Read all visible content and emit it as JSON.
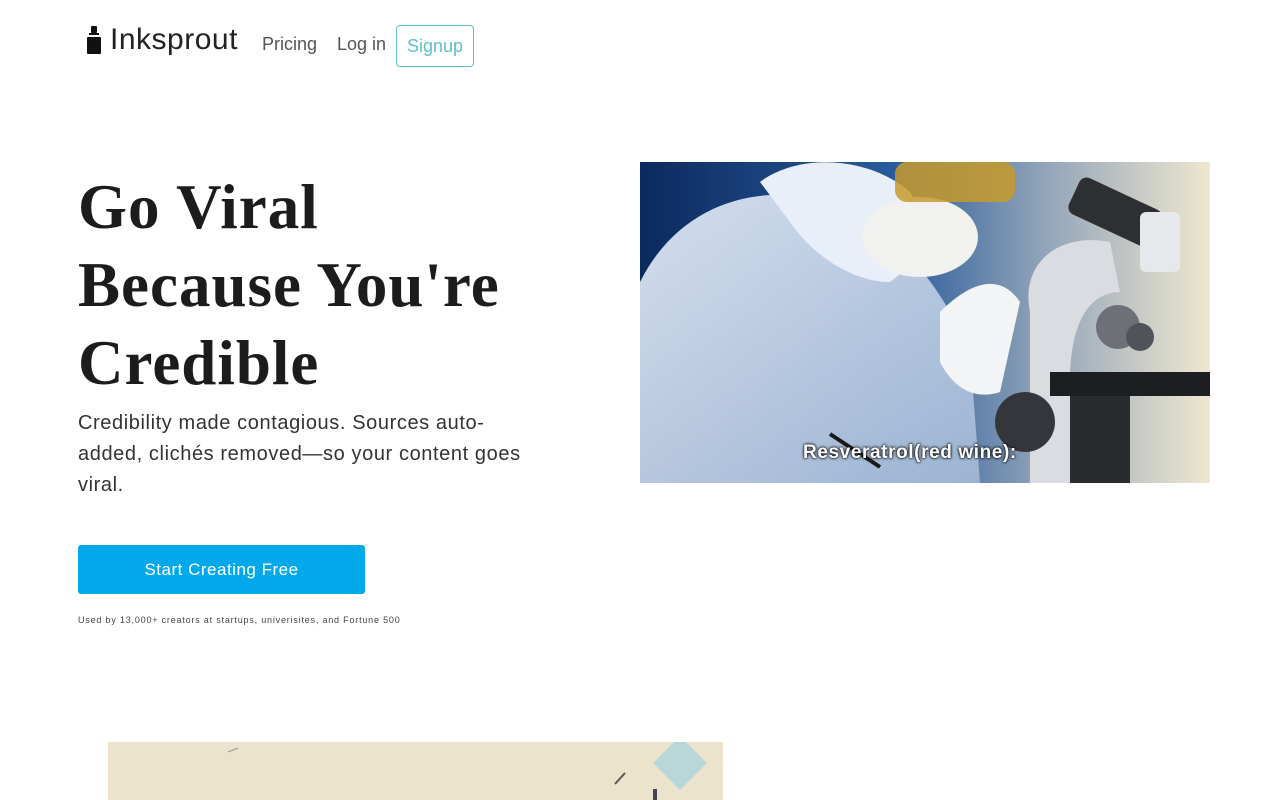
{
  "brand": {
    "name": "Inksprout",
    "icon": "ink-bottle-icon"
  },
  "nav": {
    "pricing": "Pricing",
    "login": "Log in",
    "signup": "Signup"
  },
  "hero": {
    "title_lines": [
      "Go Viral",
      "Because You're",
      "Credible"
    ],
    "subtitle": "Credibility made contagious. Sources auto-added, clichés removed—so your content goes viral.",
    "cta_label": "Start Creating Free",
    "social_proof": "Used by 13,000+ creators at startups, univerisites, and Fortune 500",
    "media_caption": "Resveratrol(red wine):"
  },
  "colors": {
    "accent": "#02a9ea",
    "signup_border": "#5bc0cf",
    "text": "#222222"
  }
}
